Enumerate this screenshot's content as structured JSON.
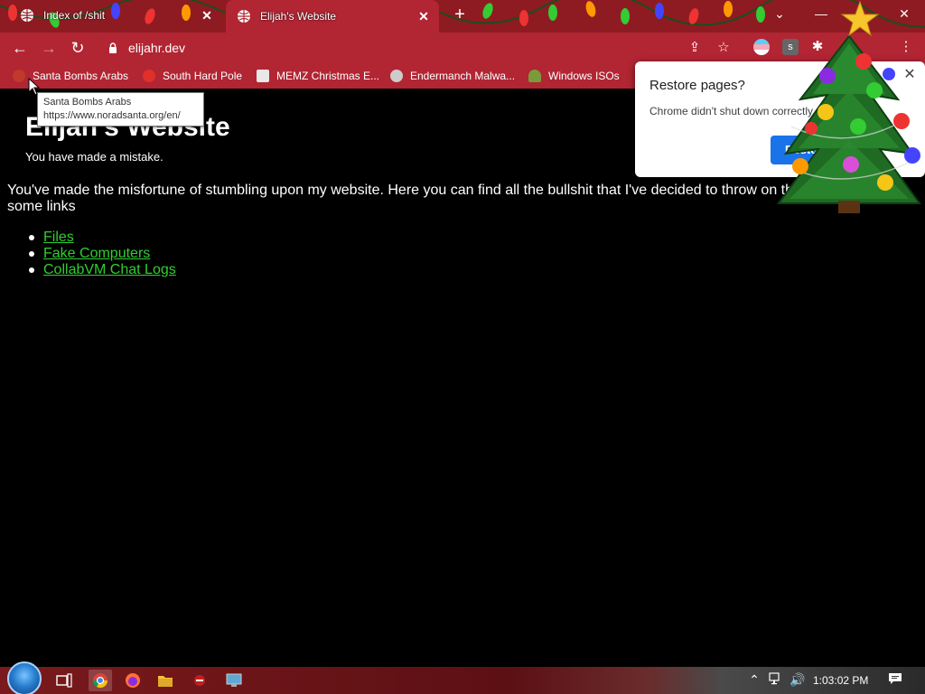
{
  "browser": {
    "tabs": [
      {
        "title": "Index of /shit",
        "close": "✕"
      },
      {
        "title": "Elijah's Website",
        "close": "✕"
      }
    ],
    "new_tab": "+",
    "url": "elijahr.dev",
    "accent_color": "#b22533"
  },
  "bookmarks": [
    {
      "label": "Santa Bombs Arabs",
      "icon_color": "#c0392b"
    },
    {
      "label": "South Hard Pole",
      "icon_color": "#e0302a"
    },
    {
      "label": "MEMZ Christmas E...",
      "icon_color": "#e8e8e8"
    },
    {
      "label": "Endermanch Malwa...",
      "icon_color": "#cccccc"
    },
    {
      "label": "Windows ISOs",
      "icon_color": "#7a9b3a"
    }
  ],
  "tooltip": {
    "title": "Santa Bombs Arabs",
    "url": "https://www.noradsanta.org/en/"
  },
  "page": {
    "title": "Elijah's Website",
    "subtitle": "You have made a mistake.",
    "intro": "You've made the misfortune of stumbling upon my website. Here you can find all the bullshit that I've decided to throw on the Internet. Here is some links",
    "links": [
      "Files",
      "Fake Computers",
      "CollabVM Chat Logs"
    ],
    "link_color": "#2fcf2f"
  },
  "restore_dialog": {
    "title": "Restore pages?",
    "body": "Chrome didn't shut down correctly.",
    "button": "Restore",
    "close": "✕"
  },
  "taskbar": {
    "clock": "1:03:02 PM"
  }
}
